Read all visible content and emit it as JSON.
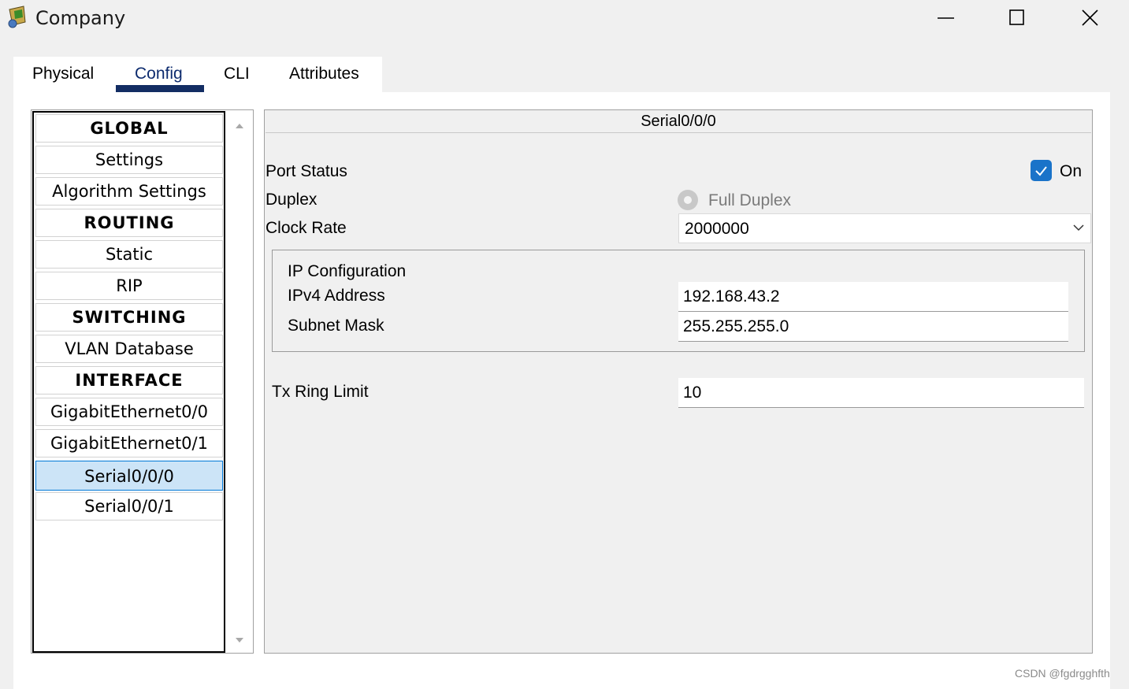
{
  "window": {
    "title": "Company"
  },
  "tabs": [
    {
      "label": "Physical"
    },
    {
      "label": "Config"
    },
    {
      "label": "CLI"
    },
    {
      "label": "Attributes"
    }
  ],
  "active_tab": "Config",
  "nav": {
    "items": [
      {
        "label": "GLOBAL",
        "type": "header"
      },
      {
        "label": "Settings",
        "type": "item"
      },
      {
        "label": "Algorithm Settings",
        "type": "item"
      },
      {
        "label": "ROUTING",
        "type": "header"
      },
      {
        "label": "Static",
        "type": "item"
      },
      {
        "label": "RIP",
        "type": "item"
      },
      {
        "label": "SWITCHING",
        "type": "header"
      },
      {
        "label": "VLAN Database",
        "type": "item"
      },
      {
        "label": "INTERFACE",
        "type": "header"
      },
      {
        "label": "GigabitEthernet0/0",
        "type": "item"
      },
      {
        "label": "GigabitEthernet0/1",
        "type": "item"
      },
      {
        "label": "Serial0/0/0",
        "type": "item",
        "selected": true
      },
      {
        "label": "Serial0/0/1",
        "type": "item"
      }
    ]
  },
  "interface": {
    "title": "Serial0/0/0",
    "port_status_label": "Port Status",
    "port_status_checked": true,
    "port_status_value": "On",
    "duplex_label": "Duplex",
    "duplex_value": "Full Duplex",
    "clock_rate_label": "Clock Rate",
    "clock_rate_value": "2000000",
    "ip_config": {
      "title": "IP Configuration",
      "ipv4_label": "IPv4 Address",
      "ipv4_value": "192.168.43.2",
      "subnet_label": "Subnet Mask",
      "subnet_value": "255.255.255.0"
    },
    "tx_ring_label": "Tx Ring Limit",
    "tx_ring_value": "10"
  },
  "watermark": "CSDN @fgdrgghfth",
  "colors": {
    "accent": "#132d63",
    "selected_bg": "#cce4f7",
    "checkbox": "#1a73c9"
  }
}
